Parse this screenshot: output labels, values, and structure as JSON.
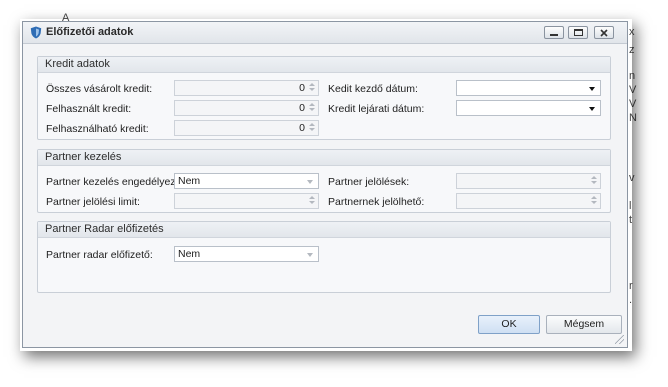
{
  "background_fragments": [
    "A",
    "x",
    "z",
    "n",
    "V",
    "V",
    "N",
    "v",
    "l",
    "t",
    "r",
    "."
  ],
  "window": {
    "title": "Előfizetői adatok",
    "controls": [
      "minimize",
      "maximize",
      "close"
    ]
  },
  "kredit": {
    "header": "Kredit adatok",
    "osszes_label": "Összes vásárolt kredit:",
    "osszes_value": "0",
    "felhasznalt_label": "Felhasznált kredit:",
    "felhasznalt_value": "0",
    "felhasznalhato_label": "Felhasználható kredit:",
    "felhasznalhato_value": "0",
    "kezdo_label": "Kedit kezdő dátum:",
    "kezdo_value": "",
    "lejarati_label": "Kredit lejárati dátum:",
    "lejarati_value": ""
  },
  "partner": {
    "header": "Partner kezelés",
    "engedelyezett_label": "Partner kezelés engedélyezett:",
    "engedelyezett_value": "Nem",
    "jelolesi_limit_label": "Partner jelölési limit:",
    "jelolesek_label": "Partner jelölések:",
    "jelolheto_label": "Partnernek jelölhető:"
  },
  "radar": {
    "header": "Partner Radar előfizetés",
    "elofizeto_label": "Partner radar előfizető:",
    "elofizeto_value": "Nem"
  },
  "buttons": {
    "ok": "OK",
    "cancel": "Mégsem"
  },
  "colors": {
    "accent": "#2f6db5",
    "window_bg": "#f3f4f6"
  }
}
